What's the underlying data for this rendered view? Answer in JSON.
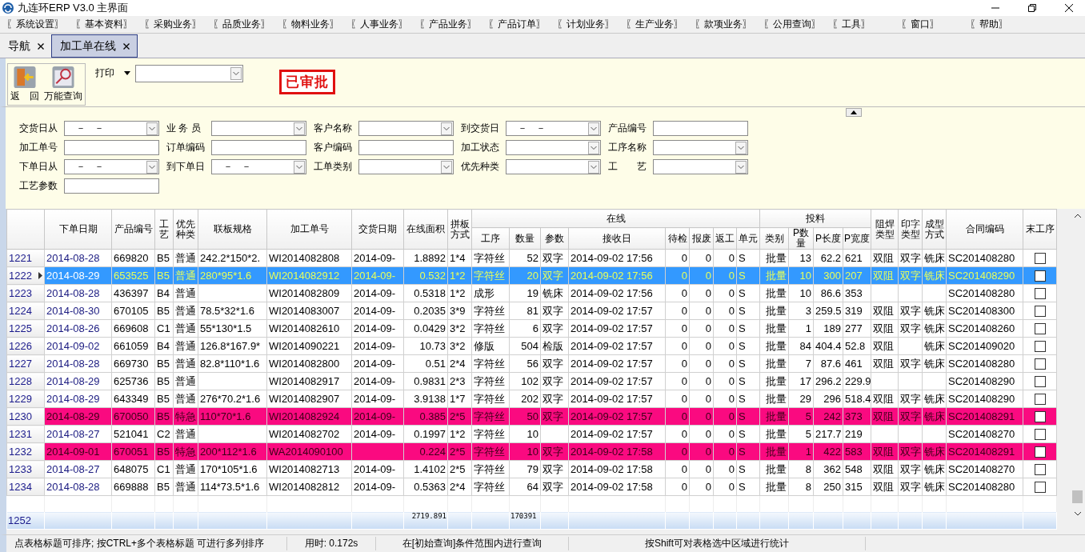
{
  "window": {
    "title": "九连环ERP V3.0 主界面"
  },
  "menu": [
    "〖系统设置〗",
    "〖基本资料〗",
    "〖采购业务〗",
    "〖品质业务〗",
    "〖物料业务〗",
    "〖人事业务〗",
    "〖产品业务〗",
    "〖产品订单〗",
    "〖计划业务〗",
    "〖生产业务〗",
    "〖款项业务〗",
    "〖公用查询〗",
    "〖工具〗",
    "〖窗口〗",
    "〖帮助〗"
  ],
  "tabs": [
    {
      "label": "导航",
      "selected": false
    },
    {
      "label": "加工单在线",
      "selected": true
    }
  ],
  "toolbar": {
    "buttons": [
      {
        "label": "返　回",
        "kind": "back"
      },
      {
        "label": "万能查询",
        "kind": "query"
      }
    ],
    "print_label": "打印",
    "stamp": "已审批"
  },
  "filters": [
    {
      "label": "交货日从",
      "kind": "date",
      "value": "－ －"
    },
    {
      "label": "业 务 员",
      "kind": "select"
    },
    {
      "label": "客户名称",
      "kind": "select"
    },
    {
      "label": "到交货日",
      "kind": "date",
      "value": "－ －"
    },
    {
      "label": "产品编号",
      "kind": "text"
    },
    {
      "label": "加工单号",
      "kind": "text"
    },
    {
      "label": "订单编码",
      "kind": "text"
    },
    {
      "label": "客户编码",
      "kind": "text"
    },
    {
      "label": "加工状态",
      "kind": "select"
    },
    {
      "label": "工序名称",
      "kind": "select"
    },
    {
      "label": "下单日从",
      "kind": "date",
      "value": "－ －"
    },
    {
      "label": "到下单日",
      "kind": "date",
      "value": "－ －"
    },
    {
      "label": "工单类别",
      "kind": "select"
    },
    {
      "label": "优先种类",
      "kind": "select"
    },
    {
      "label": "工　　艺",
      "kind": "select"
    },
    {
      "label": "工艺参数",
      "kind": "text"
    }
  ],
  "table": {
    "columns": [
      {
        "label": "下单日期"
      },
      {
        "label": "产品编号"
      },
      {
        "label": "工艺"
      },
      {
        "label": "优先种类"
      },
      {
        "label": "联板规格"
      },
      {
        "label": "加工单号"
      },
      {
        "label": "交货日期"
      },
      {
        "label": "在线面积"
      },
      {
        "label": "拼板方式"
      },
      {
        "group": "在线",
        "colspan": 8,
        "children": [
          {
            "label": "工序"
          },
          {
            "label": "数量"
          },
          {
            "label": "参数"
          },
          {
            "label": "接收日"
          },
          {
            "label": "待检"
          },
          {
            "label": "报废"
          },
          {
            "label": "返工"
          },
          {
            "label": "单元"
          }
        ]
      },
      {
        "group": "投料",
        "colspan": 4,
        "children": [
          {
            "label": "类别"
          },
          {
            "label": "P数量"
          },
          {
            "label": "P长度"
          },
          {
            "label": "P宽度"
          }
        ]
      },
      {
        "label": "阻焊类型"
      },
      {
        "label": "印字类型"
      },
      {
        "label": "成型方式"
      },
      {
        "label": "合同编码"
      },
      {
        "label": "末工序"
      }
    ],
    "rows": [
      {
        "num": "1221",
        "selected": false,
        "urgent": false,
        "last_step": false,
        "cells": [
          "2014-08-28",
          "669820",
          "B5",
          "普通",
          "242.2*150*2.",
          "WI2014082808",
          "2014-09-",
          "1.8892",
          "1*4",
          "字符丝",
          "52",
          "双字",
          "2014-09-02 17:56",
          "0",
          "0",
          "0",
          "S",
          "批量",
          "13",
          "62.2",
          "621",
          "双阻",
          "双字",
          "铣床",
          "SC201408280"
        ]
      },
      {
        "num": "1222",
        "selected": true,
        "urgent": false,
        "last_step": false,
        "cells": [
          "2014-08-29",
          "653525",
          "B5",
          "普通",
          "280*95*1.6",
          "WI2014082912",
          "2014-09-",
          "0.532",
          "1*2",
          "字符丝",
          "20",
          "双字",
          "2014-09-02 17:56",
          "0",
          "0",
          "0",
          "S",
          "批量",
          "10",
          "300",
          "207",
          "双阻",
          "双字",
          "铣床",
          "SC201408290"
        ]
      },
      {
        "num": "1223",
        "selected": false,
        "urgent": false,
        "last_step": false,
        "cells": [
          "2014-08-28",
          "436397",
          "B4",
          "普通",
          null,
          "WI2014082809",
          "2014-09-",
          "0.5318",
          "1*2",
          "成形",
          "19",
          "铣床",
          "2014-09-02 17:56",
          "0",
          "0",
          "0",
          "S",
          "批量",
          "10",
          "86.6",
          "353",
          null,
          null,
          null,
          "SC201408280"
        ]
      },
      {
        "num": "1224",
        "selected": false,
        "urgent": false,
        "last_step": false,
        "cells": [
          "2014-08-30",
          "670105",
          "B5",
          "普通",
          "78.5*32*1.6",
          "WI2014083007",
          "2014-09-",
          "0.2035",
          "3*9",
          "字符丝",
          "81",
          "双字",
          "2014-09-02 17:57",
          "0",
          "0",
          "0",
          "S",
          "批量",
          "3",
          "259.5",
          "319",
          "双阻",
          "双字",
          "铣床",
          "SC201408300"
        ]
      },
      {
        "num": "1225",
        "selected": false,
        "urgent": false,
        "last_step": false,
        "cells": [
          "2014-08-26",
          "669608",
          "C1",
          "普通",
          "55*130*1.5",
          "WI2014082610",
          "2014-09-",
          "0.0429",
          "3*2",
          "字符丝",
          "6",
          "双字",
          "2014-09-02 17:57",
          "0",
          "0",
          "0",
          "S",
          "批量",
          "1",
          "189",
          "277",
          "双阻",
          "双字",
          "铣床",
          "SC201408260"
        ]
      },
      {
        "num": "1226",
        "selected": false,
        "urgent": false,
        "last_step": false,
        "cells": [
          "2014-09-02",
          "661059",
          "B4",
          "普通",
          "126.8*167.9*",
          "WI2014090221",
          "2014-09-",
          "10.73",
          "3*2",
          "修版",
          "504",
          "检版",
          "2014-09-02 17:57",
          "0",
          "0",
          "0",
          "S",
          "批量",
          "84",
          "404.4",
          "52.8",
          "双阻",
          null,
          "铣床",
          "SC201409020"
        ]
      },
      {
        "num": "1227",
        "selected": false,
        "urgent": false,
        "last_step": false,
        "cells": [
          "2014-08-28",
          "669730",
          "B5",
          "普通",
          "82.8*110*1.6",
          "WI2014082800",
          "2014-09-",
          "0.51",
          "2*4",
          "字符丝",
          "56",
          "双字",
          "2014-09-02 17:57",
          "0",
          "0",
          "0",
          "S",
          "批量",
          "7",
          "87.6",
          "461",
          "双阻",
          "双字",
          "铣床",
          "SC201408280"
        ]
      },
      {
        "num": "1228",
        "selected": false,
        "urgent": false,
        "last_step": false,
        "cells": [
          "2014-08-29",
          "625736",
          "B5",
          "普通",
          null,
          "WI2014082917",
          "2014-09-",
          "0.9831",
          "2*3",
          "字符丝",
          "102",
          "双字",
          "2014-09-02 17:57",
          "0",
          "0",
          "0",
          "S",
          "批量",
          "17",
          "296.2",
          "229.9",
          null,
          null,
          null,
          "SC201408290"
        ]
      },
      {
        "num": "1229",
        "selected": false,
        "urgent": false,
        "last_step": false,
        "cells": [
          "2014-08-29",
          "643349",
          "B5",
          "普通",
          "276*70.2*1.6",
          "WI2014082907",
          "2014-09-",
          "3.9138",
          "1*7",
          "字符丝",
          "202",
          "双字",
          "2014-09-02 17:57",
          "0",
          "0",
          "0",
          "S",
          "批量",
          "29",
          "296",
          "518.4",
          "双阻",
          "双字",
          "铣床",
          "SC201408290"
        ]
      },
      {
        "num": "1230",
        "selected": false,
        "urgent": true,
        "last_step": false,
        "cells": [
          "2014-08-29",
          "670050",
          "B5",
          "特急",
          "110*70*1.6",
          "WI2014082924",
          "2014-09-",
          "0.385",
          "2*5",
          "字符丝",
          "50",
          "双字",
          "2014-09-02 17:57",
          "0",
          "0",
          "0",
          "S",
          "批量",
          "5",
          "242",
          "373",
          "双阻",
          "双字",
          "铣床",
          "SC201408291"
        ]
      },
      {
        "num": "1231",
        "selected": false,
        "urgent": false,
        "last_step": false,
        "cells": [
          "2014-08-27",
          "521041",
          "C2",
          "普通",
          null,
          "WI2014082702",
          "2014-09-",
          "0.1997",
          "1*2",
          "字符丝",
          "10",
          null,
          "2014-09-02 17:57",
          "0",
          "0",
          "0",
          "S",
          "批量",
          "5",
          "217.7",
          "219",
          null,
          null,
          null,
          "SC201408270"
        ]
      },
      {
        "num": "1232",
        "selected": false,
        "urgent": true,
        "last_step": false,
        "cells": [
          "2014-09-01",
          "670051",
          "B5",
          "特急",
          "200*112*1.6",
          "WA2014090100",
          null,
          "0.224",
          "2*5",
          "字符丝",
          "10",
          "双字",
          "2014-09-02 17:58",
          "0",
          "0",
          "0",
          "S",
          "批量",
          "1",
          "422",
          "583",
          "双阻",
          "双字",
          "铣床",
          "SC201408291"
        ]
      },
      {
        "num": "1233",
        "selected": false,
        "urgent": false,
        "last_step": false,
        "cells": [
          "2014-08-27",
          "648075",
          "C1",
          "普通",
          "170*105*1.6",
          "WI2014082713",
          "2014-09-",
          "1.4102",
          "2*5",
          "字符丝",
          "79",
          "双字",
          "2014-09-02 17:58",
          "0",
          "0",
          "0",
          "S",
          "批量",
          "8",
          "362",
          "548",
          "双阻",
          "双字",
          "铣床",
          "SC201408270"
        ]
      },
      {
        "num": "1234",
        "selected": false,
        "urgent": false,
        "last_step": false,
        "cells": [
          "2014-08-28",
          "669888",
          "B5",
          "普通",
          "114*73.5*1.6",
          "WI2014082812",
          "2014-09-",
          "0.5363",
          "2*4",
          "字符丝",
          "64",
          "双字",
          "2014-09-02 17:58",
          "0",
          "0",
          "0",
          "S",
          "批量",
          "8",
          "250",
          "315",
          "双阻",
          "双字",
          "铣床",
          "SC201408280"
        ]
      }
    ],
    "footer": {
      "count": "1252",
      "cells": [
        null,
        null,
        null,
        null,
        null,
        null,
        null,
        "2719.891",
        null,
        null,
        "170391",
        null,
        null,
        null,
        null,
        null,
        null,
        null,
        null,
        null,
        null,
        null,
        null,
        null,
        null,
        null
      ]
    }
  },
  "status_bar": [
    "点表格标题可排序; 按CTRL+多个表格标题 可进行多列排序",
    "用时: 0.172s",
    "在[初始查询]条件范围内进行查询",
    "按Shift可对表格选中区域进行统计"
  ]
}
